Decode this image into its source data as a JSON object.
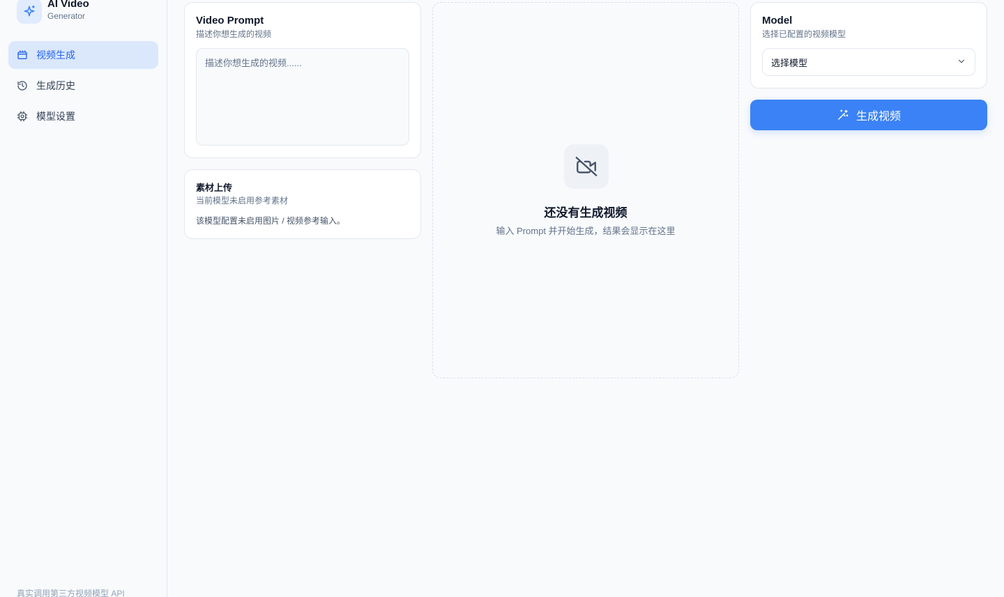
{
  "app": {
    "title": "AI Video",
    "subtitle": "Generator",
    "logo_icon": "sparkles-icon",
    "accent": "#3b82f6"
  },
  "sidebar": {
    "items": [
      {
        "label": "视频生成",
        "icon": "video-icon",
        "active": true
      },
      {
        "label": "生成历史",
        "icon": "history-icon",
        "active": false
      },
      {
        "label": "模型设置",
        "icon": "settings-icon",
        "active": false
      }
    ],
    "footer": "真实调用第三方视频模型 API"
  },
  "prompt": {
    "title": "Video Prompt",
    "description": "描述你想生成的视频",
    "placeholder": "描述你想生成的视频......",
    "value": ""
  },
  "upload": {
    "title": "素材上传",
    "description": "当前模型未启用参考素材",
    "note": "该模型配置未启用图片 / 视频参考输入。"
  },
  "preview": {
    "icon": "video-off-icon",
    "title": "还没有生成视频",
    "subtitle": "输入 Prompt 并开始生成，结果会显示在这里"
  },
  "model": {
    "title": "Model",
    "description": "选择已配置的视频模型",
    "selected": "选择模型"
  },
  "actions": {
    "generate_label": "生成视频",
    "generate_icon": "magic-wand-icon"
  }
}
